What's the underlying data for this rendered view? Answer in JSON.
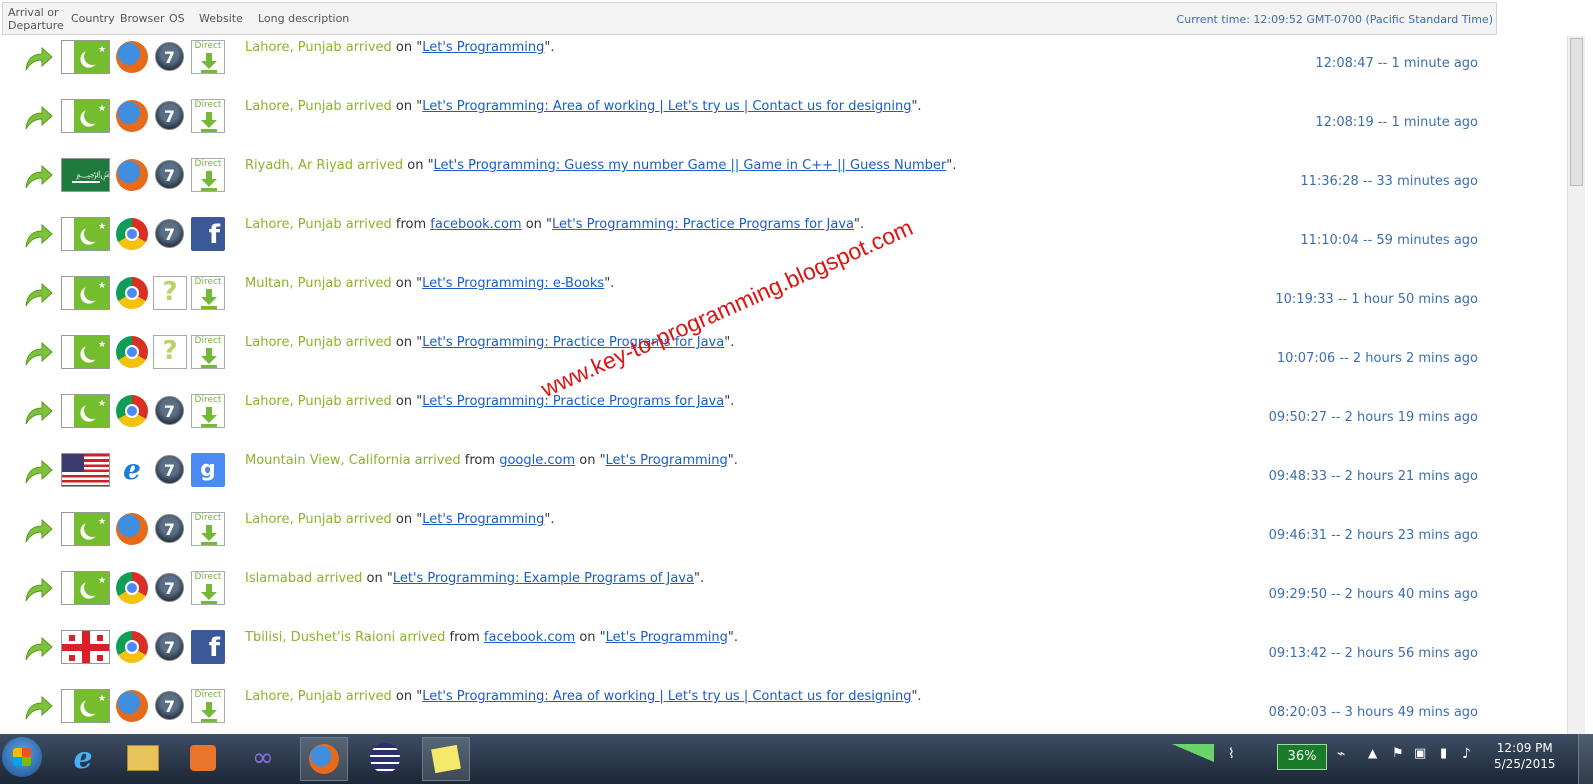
{
  "header": {
    "col_arrival": "Arrival or Departure",
    "col_country": "Country",
    "col_browser": "Browser",
    "col_os": "OS",
    "col_website": "Website",
    "col_long_description": "Long description",
    "current_time": "Current time: 12:09:52 GMT-0700 (Pacific Standard Time)"
  },
  "rows": [
    {
      "flag": "pakistan-flag",
      "browser": "firefox-icon",
      "os": "windows7-icon",
      "website": "direct-icon",
      "location": "Lahore, Punjab arrived",
      "referrer_prefix": "",
      "referrer": "",
      "on": " on \"",
      "page": "Let's Programming",
      "end": "\".",
      "time": "12:08:47 -- 1 minute ago"
    },
    {
      "flag": "pakistan-flag",
      "browser": "firefox-icon",
      "os": "windows7-icon",
      "website": "direct-icon",
      "location": "Lahore, Punjab arrived",
      "referrer_prefix": "",
      "referrer": "",
      "on": " on \"",
      "page": "Let's Programming: Area of working | Let's try us | Contact us for designing",
      "end": "\".",
      "time": "12:08:19 -- 1 minute ago"
    },
    {
      "flag": "saudi-arabia-flag",
      "browser": "firefox-icon",
      "os": "windows7-icon",
      "website": "direct-icon",
      "location": "Riyadh, Ar Riyad arrived",
      "referrer_prefix": "",
      "referrer": "",
      "on": " on \"",
      "page": "Let's Programming: Guess my number Game || Game in C++ || Guess Number",
      "end": "\".",
      "time": "11:36:28 -- 33 minutes ago"
    },
    {
      "flag": "pakistan-flag",
      "browser": "chrome-icon",
      "os": "windows7-icon",
      "website": "facebook-icon",
      "location": "Lahore, Punjab arrived",
      "referrer_prefix": " from ",
      "referrer": "facebook.com",
      "on": " on \"",
      "page": "Let's Programming: Practice Programs for Java",
      "end": "\".",
      "time": "11:10:04 -- 59 minutes ago"
    },
    {
      "flag": "pakistan-flag",
      "browser": "chrome-icon",
      "os": "unknown-os-icon",
      "website": "direct-icon",
      "location": "Multan, Punjab arrived",
      "referrer_prefix": "",
      "referrer": "",
      "on": " on \"",
      "page": "Let's Programming: e-Books",
      "end": "\".",
      "time": "10:19:33 -- 1 hour 50 mins ago"
    },
    {
      "flag": "pakistan-flag",
      "browser": "chrome-icon",
      "os": "unknown-os-icon",
      "website": "direct-icon",
      "location": "Lahore, Punjab arrived",
      "referrer_prefix": "",
      "referrer": "",
      "on": " on \"",
      "page": "Let's Programming: Practice Programs for Java",
      "end": "\".",
      "time": "10:07:06 -- 2 hours 2 mins ago"
    },
    {
      "flag": "pakistan-flag",
      "browser": "chrome-icon",
      "os": "windows7-icon",
      "website": "direct-icon",
      "location": "Lahore, Punjab arrived",
      "referrer_prefix": "",
      "referrer": "",
      "on": " on \"",
      "page": "Let's Programming: Practice Programs for Java",
      "end": "\".",
      "time": "09:50:27 -- 2 hours 19 mins ago"
    },
    {
      "flag": "usa-flag",
      "browser": "internet-explorer-icon",
      "os": "windows7-icon",
      "website": "google-icon",
      "location": "Mountain View, California arrived",
      "referrer_prefix": " from ",
      "referrer": "google.com",
      "on": " on \"",
      "page": "Let's Programming",
      "end": "\".",
      "time": "09:48:33 -- 2 hours 21 mins ago"
    },
    {
      "flag": "pakistan-flag",
      "browser": "firefox-icon",
      "os": "windows7-icon",
      "website": "direct-icon",
      "location": "Lahore, Punjab arrived",
      "referrer_prefix": "",
      "referrer": "",
      "on": " on \"",
      "page": "Let's Programming",
      "end": "\".",
      "time": "09:46:31 -- 2 hours 23 mins ago"
    },
    {
      "flag": "pakistan-flag",
      "browser": "chrome-icon",
      "os": "windows7-icon",
      "website": "direct-icon",
      "location": "Islamabad arrived",
      "referrer_prefix": "",
      "referrer": "",
      "on": " on \"",
      "page": "Let's Programming: Example Programs of Java",
      "end": "\".",
      "time": "09:29:50 -- 2 hours 40 mins ago"
    },
    {
      "flag": "georgia-flag",
      "browser": "chrome-icon",
      "os": "windows7-icon",
      "website": "facebook-icon",
      "location": "Tbilisi, Dushet'is Raioni arrived",
      "referrer_prefix": " from ",
      "referrer": "facebook.com",
      "on": " on \"",
      "page": "Let's Programming",
      "end": "\".",
      "time": "09:13:42 -- 2 hours 56 mins ago"
    },
    {
      "flag": "pakistan-flag",
      "browser": "firefox-icon",
      "os": "windows7-icon",
      "website": "direct-icon",
      "location": "Lahore, Punjab arrived",
      "referrer_prefix": "",
      "referrer": "",
      "on": " on \"",
      "page": "Let's Programming: Area of working | Let's try us | Contact us for designing",
      "end": "\".",
      "time": "08:20:03 -- 3 hours 49 mins ago"
    }
  ],
  "icon_text": {
    "direct": "Direct",
    "unknown": "?",
    "win7": "7",
    "facebook": "f",
    "google": "g",
    "ie": "e"
  },
  "watermark": "www.key-to-programming.blogspot.com",
  "taskbar": {
    "battery": "36%",
    "clock_time": "12:09 PM",
    "clock_date": "5/25/2015",
    "apps": [
      "internet-explorer-icon",
      "file-explorer-icon",
      "media-player-icon",
      "visual-studio-icon",
      "firefox-icon",
      "eclipse-icon",
      "sticky-notes-icon"
    ]
  },
  "colors": {
    "location_green": "#8bb32b",
    "link_blue": "#1a5dc9",
    "time_blue": "#3d6eae",
    "watermark_red": "#e01212"
  }
}
